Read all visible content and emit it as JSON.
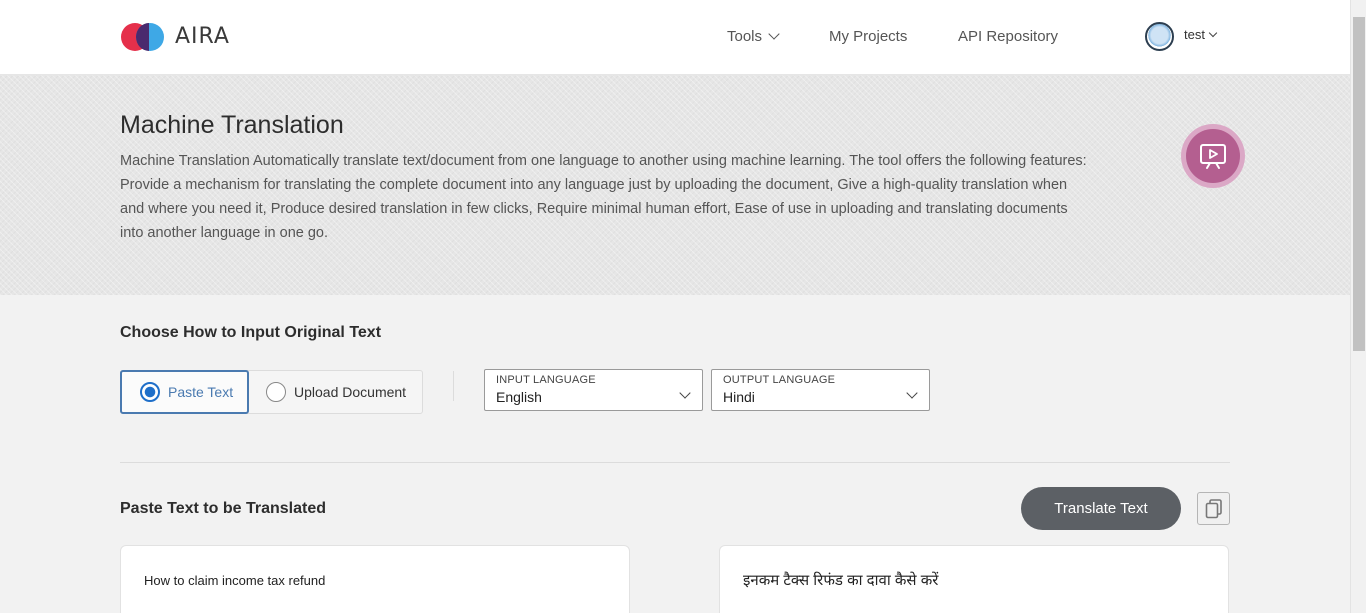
{
  "app": {
    "brand": "AIRA"
  },
  "nav": {
    "tools": "Tools",
    "projects": "My Projects",
    "api": "API Repository"
  },
  "user": {
    "name": "test"
  },
  "hero": {
    "title": "Machine Translation",
    "description": "Machine Translation Automatically translate text/document from one language to another using machine learning. The tool offers the following features: Provide a mechanism for translating the complete document into any language just by uploading the document, Give a high-quality translation when and where you need it, Produce desired translation in few clicks, Require minimal human effort, Ease of use in uploading and translating documents into another language in one go."
  },
  "input_section": {
    "title": "Choose How to Input Original Text",
    "options": [
      {
        "label": "Paste Text",
        "selected": true
      },
      {
        "label": "Upload Document",
        "selected": false
      }
    ]
  },
  "languages": {
    "input_label": "INPUT LANGUAGE",
    "input_value": "English",
    "output_label": "OUTPUT LANGUAGE",
    "output_value": "Hindi"
  },
  "paste_section": {
    "title": "Paste Text to be Translated",
    "translate_button": "Translate Text",
    "source_text": "How to claim income tax refund",
    "translated_text": "इनकम टैक्स रिफंड का दावा कैसे करें"
  },
  "colors": {
    "accent": "#1f6fc9",
    "selected_border": "#4a7ab0",
    "button_bg": "#5c6065",
    "video_button": "#b45f90"
  },
  "icons": [
    "chevron-down-icon",
    "video-play-icon",
    "copy-icon",
    "avatar"
  ]
}
